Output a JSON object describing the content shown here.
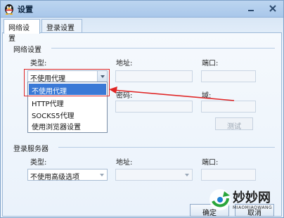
{
  "window": {
    "title": "设置"
  },
  "tabs": [
    {
      "label": "网络设置",
      "active": true
    },
    {
      "label": "登录设置",
      "active": false
    }
  ],
  "network": {
    "section_title": "网络设置",
    "type_label": "类型:",
    "type_value": "不使用代理",
    "address_label": "地址:",
    "port_label": "端口:",
    "password_label": "密码:",
    "domain_label": "域:",
    "test_button": "测试",
    "dropdown_options": [
      "不使用代理",
      "HTTP代理",
      "SOCKS5代理",
      "使用浏览器设置"
    ],
    "dropdown_selected_index": 0
  },
  "login_server": {
    "section_title": "登录服务器",
    "type_label": "类型:",
    "type_value": "不使用高级选项",
    "address_label": "地址:",
    "port_label": "端口:"
  },
  "footer": {
    "ok_button": "确定",
    "cancel_button": "取消"
  },
  "watermark": {
    "text": "妙妙网",
    "subtext": "MIAOMIAOWANG"
  },
  "colors": {
    "accent": "#3a79d6",
    "highlight_box": "#e02525",
    "title_bar": "#a9c7ea"
  }
}
